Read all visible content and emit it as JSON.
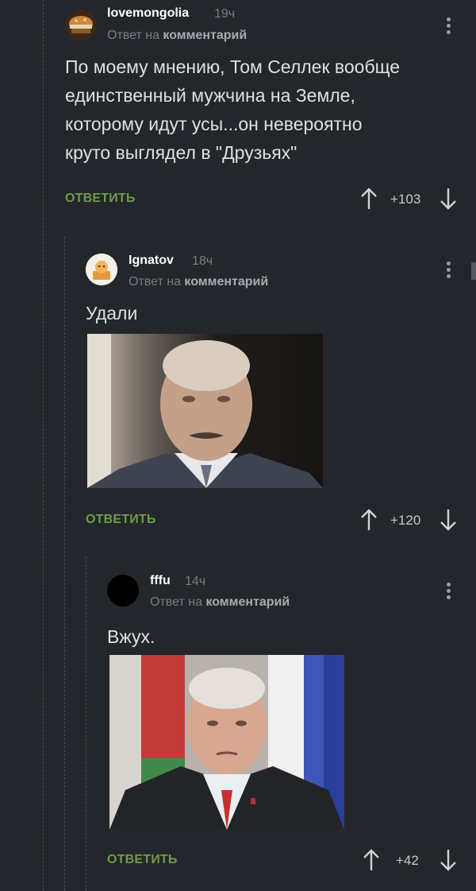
{
  "comments": [
    {
      "username": "lovemongolia",
      "time": "19ч",
      "reply_prefix": "Ответ на",
      "reply_target": "комментарий",
      "text": "По моему мнению, Том Селлек вообще\nединственный мужчина на Земле,\nкоторому идут усы...он невероятно\nкруто выглядел в \"Друзьях\"",
      "reply_label": "ОТВЕТИТЬ",
      "score": "+103"
    },
    {
      "username": "Ignatov",
      "time": "18ч",
      "reply_prefix": "Ответ на",
      "reply_target": "комментарий",
      "text": "Удали",
      "reply_label": "ОТВЕТИТЬ",
      "score": "+120"
    },
    {
      "username": "fffu",
      "time": "14ч",
      "reply_prefix": "Ответ на",
      "reply_target": "комментарий",
      "text": "Вжух.",
      "reply_label": "ОТВЕТИТЬ",
      "score": "+42"
    }
  ],
  "colors": {
    "background": "#23262a",
    "reply_button": "#6f9b4a",
    "muted_text": "#7a7d82"
  },
  "icons": [
    "upvote-arrow-icon",
    "downvote-arrow-icon",
    "more-options-icon"
  ]
}
